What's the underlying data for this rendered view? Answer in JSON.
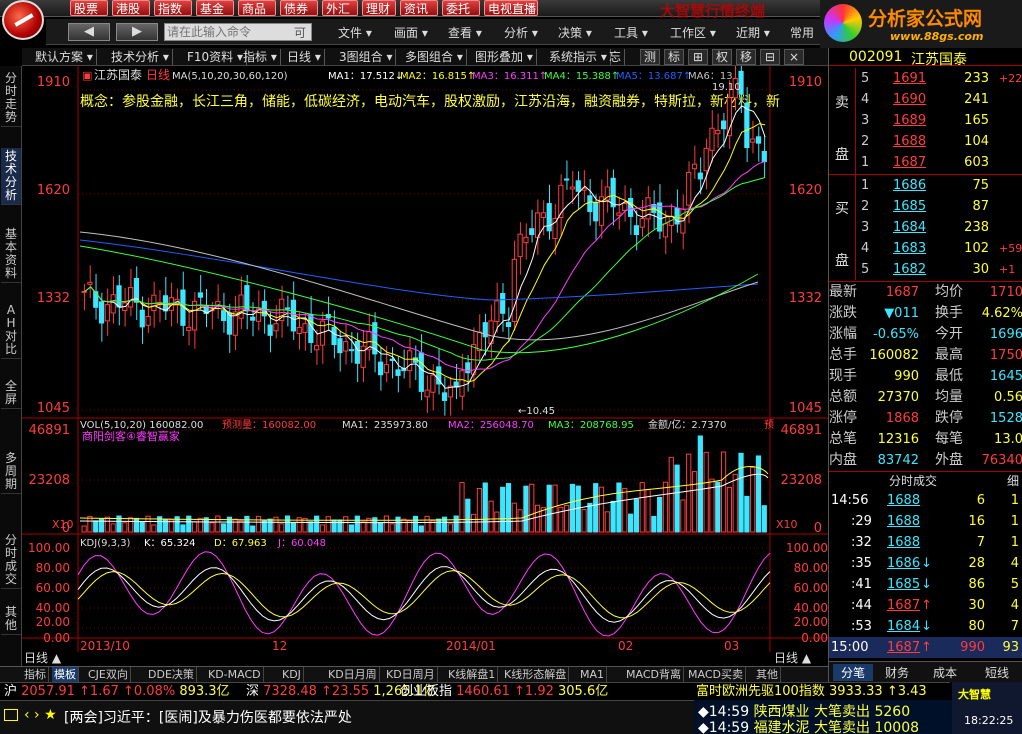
{
  "topnav": {
    "items": [
      "股票",
      "港股",
      "指数",
      "基金",
      "商品",
      "债券",
      "外汇",
      "理财",
      "资讯",
      "委托",
      "电视直播"
    ],
    "watermark": "大智慧行情终端"
  },
  "toolbar2": {
    "back_icon": "arrow-left-icon",
    "forward_icon": "arrow-right-icon",
    "cmd_placeholder": "请在此输入命令",
    "cmd_hint": "可",
    "menus": [
      "文件",
      "画面",
      "查看",
      "分析",
      "决策",
      "工具",
      "工作区",
      "近期",
      "常用"
    ]
  },
  "brand": {
    "name": "分析家公式网",
    "url": "www.88gs.com"
  },
  "chart_tabs": {
    "items": [
      "默认方案",
      "技术分析",
      "F10资料",
      "指标",
      "日线",
      "3图组合",
      "多图组合",
      "图形叠加",
      "系统指示",
      "忘"
    ],
    "tools": [
      "测",
      "标",
      "⊞",
      "权",
      "移",
      "⊟",
      "×"
    ]
  },
  "left_tabs": [
    "分时走势",
    "技术分析",
    "基本资料",
    "AH对比",
    "全屏",
    "多周期",
    "分时成交",
    "其他"
  ],
  "main_chart": {
    "title": "江苏国泰",
    "period": "日线",
    "ma_label": "MA(5,10,20,30,60,120)",
    "ma_values": [
      {
        "name": "MA1",
        "value": "17.512",
        "dir": "↓"
      },
      {
        "name": "MA2",
        "value": "16.815",
        "dir": "↑"
      },
      {
        "name": "MA3",
        "value": "16.311",
        "dir": "↑"
      },
      {
        "name": "MA4",
        "value": "15.388",
        "dir": "↑"
      },
      {
        "name": "MA5",
        "value": "13.687",
        "dir": "↑"
      },
      {
        "name": "MA6",
        "value": "13",
        "dir": ""
      }
    ],
    "concept": "概念：参股金融，长江三角，储能，低碳经济，电动汽车，股权激励，江苏沿海，融资融券，特斯拉，新材料，新",
    "high_label": "19.10",
    "low_label": "10.45"
  },
  "vol_panel": {
    "label": "VOL(5,10,20)",
    "value": "160082.00",
    "forecast": "预测量：160082.00",
    "ma1": "MA1：235973.80",
    "ma2": "MA2：256048.70",
    "ma3": "MA3：208768.95",
    "amount": "金额/亿：2.7370",
    "amount_more": "预",
    "sub": "商阳剑客④睿智赢家",
    "x10": "X10"
  },
  "kdj_panel": {
    "label": "KDJ(9,3,3)",
    "k": "K：65.324",
    "d": "D：67.963",
    "j": "J：60.048"
  },
  "axis": {
    "price_labels": [
      "1910",
      "1620",
      "1332",
      "1045"
    ],
    "vol_labels": [
      "46891",
      "23208",
      "0"
    ],
    "kdj_labels": [
      "100.00",
      "80.00",
      "60.00",
      "50.00",
      "40.00",
      "20.00",
      "0.00"
    ],
    "date_labels": [
      "2013/10",
      "12",
      "2014/01",
      "02",
      "03"
    ],
    "period_left": "日线",
    "period_right": "日线"
  },
  "index_tabs": [
    "指标",
    "模板",
    "CJE双向",
    "DDE决策",
    "KD-MACD",
    "KDJ",
    "KD日月周",
    "KD日周月",
    "K线解盘1",
    "K线形态解盘",
    "MA1",
    "MACD背离",
    "MACD买卖",
    "其他"
  ],
  "ticker": {
    "items": [
      {
        "label": "沪",
        "value": "2057.91",
        "change": "↑1.67",
        "pct": "↑0.08%",
        "amt": "893.3亿"
      },
      {
        "label": "深",
        "value": "7328.48",
        "change": "↑23.55",
        "pct": "",
        "amt": "1,265.1亿"
      },
      {
        "label": "创业板指",
        "value": "1460.61",
        "change": "↑1.92",
        "pct": "",
        "amt": "305.6亿"
      }
    ],
    "scroll": "富时欧洲先驱100指数 3933.33 ↑3.43"
  },
  "news": {
    "mail_icon": "mail-icon",
    "text": "[两会]习近平：[医闹]及暴力伤医都要依法严处"
  },
  "alerts": [
    {
      "time": "14:59",
      "name": "陕西煤业",
      "action": "大笔卖出",
      "value": "5260"
    },
    {
      "time": "14:59",
      "name": "福建水泥",
      "action": "大笔卖出",
      "value": "10008"
    }
  ],
  "clock": {
    "brand": "大智慧",
    "time": "18:22:25"
  },
  "quote_panel": {
    "code": "002091",
    "name": "江苏国泰",
    "sell_label": "卖盘",
    "buy_label": "买盘",
    "sells": [
      {
        "level": "5",
        "price": "1691",
        "vol": "233",
        "chg": "+223"
      },
      {
        "level": "4",
        "price": "1690",
        "vol": "241",
        "chg": ""
      },
      {
        "level": "3",
        "price": "1689",
        "vol": "165",
        "chg": ""
      },
      {
        "level": "2",
        "price": "1688",
        "vol": "104",
        "chg": ""
      },
      {
        "level": "1",
        "price": "1687",
        "vol": "603",
        "chg": ""
      }
    ],
    "buys": [
      {
        "level": "1",
        "price": "1686",
        "vol": "75",
        "chg": ""
      },
      {
        "level": "2",
        "price": "1685",
        "vol": "87",
        "chg": ""
      },
      {
        "level": "3",
        "price": "1684",
        "vol": "238",
        "chg": ""
      },
      {
        "level": "4",
        "price": "1683",
        "vol": "102",
        "chg": "+59"
      },
      {
        "level": "5",
        "price": "1682",
        "vol": "30",
        "chg": "+1"
      }
    ],
    "stats": [
      {
        "l1": "最新",
        "v1": "1687",
        "l2": "均价",
        "v2": "1710",
        "c1": "red",
        "c2": "red"
      },
      {
        "l1": "涨跌",
        "v1": "▼011",
        "l2": "换手",
        "v2": "4.62%",
        "c1": "cyan",
        "c2": "yellow"
      },
      {
        "l1": "涨幅",
        "v1": "-0.65%",
        "l2": "今开",
        "v2": "1696",
        "c1": "cyan",
        "c2": "cyan"
      },
      {
        "l1": "总手",
        "v1": "160082",
        "l2": "最高",
        "v2": "1750",
        "c1": "yellow",
        "c2": "red"
      },
      {
        "l1": "现手",
        "v1": "990",
        "l2": "最低",
        "v2": "1645",
        "c1": "yellow",
        "c2": "cyan"
      },
      {
        "l1": "总额",
        "v1": "27370",
        "l2": "均量",
        "v2": "0.56",
        "c1": "yellow",
        "c2": "yellow"
      },
      {
        "l1": "涨停",
        "v1": "1868",
        "l2": "跌停",
        "v2": "1528",
        "c1": "red",
        "c2": "cyan"
      },
      {
        "l1": "总笔",
        "v1": "12316",
        "l2": "每笔",
        "v2": "13.0",
        "c1": "yellow",
        "c2": "yellow"
      },
      {
        "l1": "内盘",
        "v1": "83742",
        "l2": "外盘",
        "v2": "76340",
        "c1": "cyan",
        "c2": "red"
      }
    ],
    "trades_title": "分时成交",
    "trades_corner": "细",
    "trades": [
      {
        "time": "14:56",
        "price": "1688",
        "arrow": "",
        "vol": "6",
        "n": "1"
      },
      {
        "time": ":29",
        "price": "1688",
        "arrow": "",
        "vol": "16",
        "n": "1"
      },
      {
        "time": ":32",
        "price": "1688",
        "arrow": "",
        "vol": "7",
        "n": "1"
      },
      {
        "time": ":35",
        "price": "1686",
        "arrow": "↓",
        "vol": "28",
        "n": "4"
      },
      {
        "time": ":41",
        "price": "1685",
        "arrow": "↓",
        "vol": "86",
        "n": "5"
      },
      {
        "time": ":44",
        "price": "1687",
        "arrow": "↑",
        "vol": "30",
        "n": "4"
      },
      {
        "time": ":53",
        "price": "1684",
        "arrow": "↓",
        "vol": "80",
        "n": "7"
      },
      {
        "time": "15:00",
        "price": "1687",
        "arrow": "↑",
        "vol": "990",
        "n": "93"
      }
    ],
    "tabs": [
      "分笔",
      "财务",
      "成本",
      "短线"
    ]
  },
  "colors": {
    "up": "#ff3c3c",
    "down": "#3ce6ff",
    "ma1": "#ffffff",
    "ma2": "#ffff00",
    "ma3": "#ff3cff",
    "ma4": "#3cff3c",
    "ma5": "#2060ff",
    "ma6": "#c0c0c0"
  }
}
